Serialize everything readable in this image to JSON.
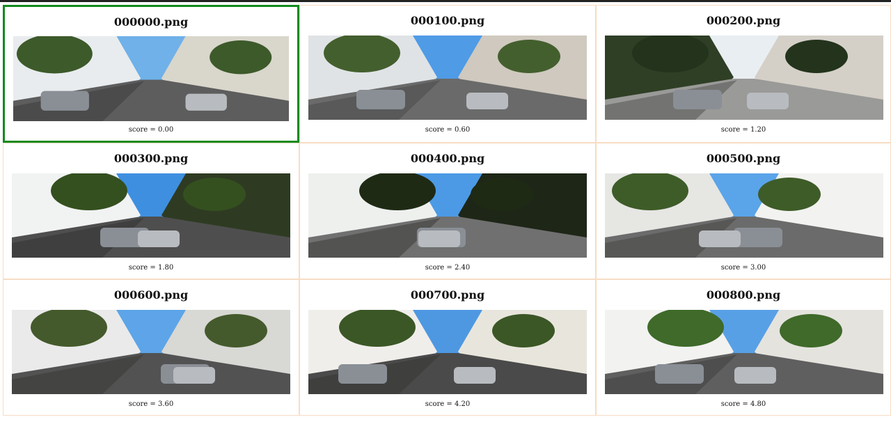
{
  "accent_color": "#118a1e",
  "border_color": "#f7dcc4",
  "results": [
    {
      "filename": "000000.png",
      "score_text": "score = 0.00",
      "selected": true,
      "scene": "street-trees-parked-car"
    },
    {
      "filename": "000100.png",
      "score_text": "score = 0.60",
      "selected": false,
      "scene": "street-buildings-cars"
    },
    {
      "filename": "000200.png",
      "score_text": "score = 1.20",
      "selected": false,
      "scene": "street-hedge-houses"
    },
    {
      "filename": "000300.png",
      "score_text": "score = 1.80",
      "selected": false,
      "scene": "street-white-wall-cars"
    },
    {
      "filename": "000400.png",
      "score_text": "score = 2.40",
      "selected": false,
      "scene": "street-white-building-shade"
    },
    {
      "filename": "000500.png",
      "score_text": "score = 3.00",
      "selected": false,
      "scene": "street-blue-car-houses"
    },
    {
      "filename": "000600.png",
      "score_text": "score = 3.60",
      "selected": false,
      "scene": "street-parked-cars-trees"
    },
    {
      "filename": "000700.png",
      "score_text": "score = 4.20",
      "selected": false,
      "scene": "street-red-roofs-cars"
    },
    {
      "filename": "000800.png",
      "score_text": "score = 4.80",
      "selected": false,
      "scene": "street-gray-car-fence"
    }
  ]
}
